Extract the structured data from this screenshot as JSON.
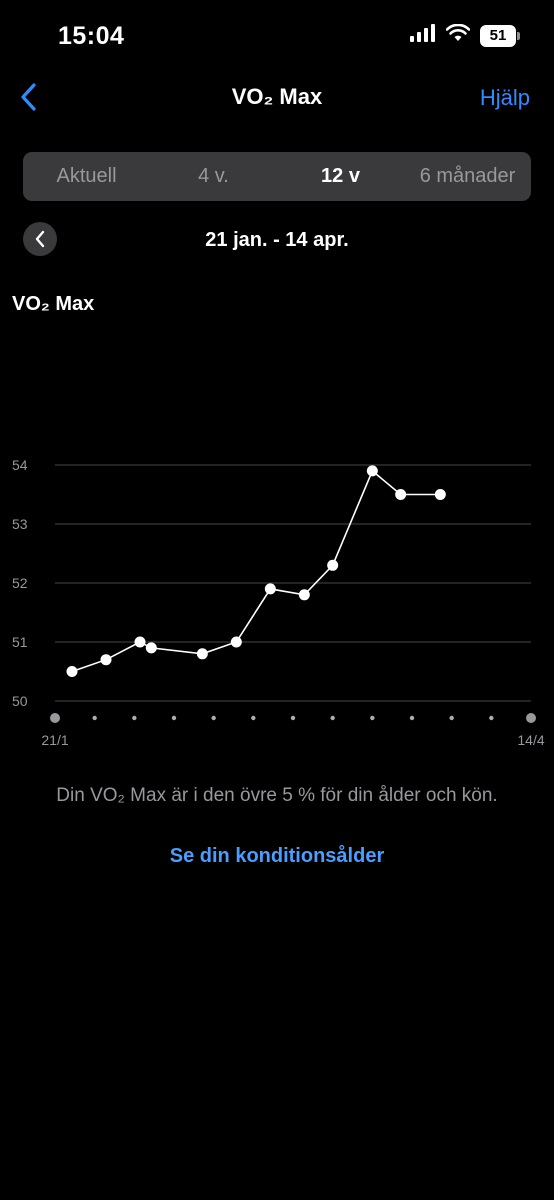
{
  "status_bar": {
    "time": "15:04",
    "battery": "51"
  },
  "nav": {
    "title": "VO₂ Max",
    "help": "Hjälp"
  },
  "segments": [
    {
      "label": "Aktuell",
      "active": false
    },
    {
      "label": "4 v.",
      "active": false
    },
    {
      "label": "12 v",
      "active": true
    },
    {
      "label": "6 månader",
      "active": false
    }
  ],
  "date_range": "21 jan. - 14 apr.",
  "chart_title": "VO₂ Max",
  "chart_data": {
    "type": "line",
    "title": "VO₂ Max",
    "ylim": [
      50,
      54
    ],
    "yticks": [
      "50",
      "51",
      "52",
      "53",
      "54"
    ],
    "x_start_label": "21/1",
    "x_end_label": "14/4",
    "x_range_days": [
      0,
      84
    ],
    "grid": true,
    "color": "#ffffff",
    "points": [
      {
        "x": 3,
        "y": 50.5
      },
      {
        "x": 9,
        "y": 50.7
      },
      {
        "x": 15,
        "y": 51.0
      },
      {
        "x": 17,
        "y": 50.9
      },
      {
        "x": 26,
        "y": 50.8
      },
      {
        "x": 32,
        "y": 51.0
      },
      {
        "x": 38,
        "y": 51.9
      },
      {
        "x": 44,
        "y": 51.8
      },
      {
        "x": 49,
        "y": 52.3
      },
      {
        "x": 56,
        "y": 53.9
      },
      {
        "x": 61,
        "y": 53.5
      },
      {
        "x": 68,
        "y": 53.5
      }
    ]
  },
  "insight_text": "Din VO₂ Max är i den övre 5 % för din ålder och kön.",
  "link_text": "Se din konditionsålder",
  "colors": {
    "accent": "#2f8cff",
    "background": "#000000",
    "segment_bg": "#3a3a3c"
  }
}
